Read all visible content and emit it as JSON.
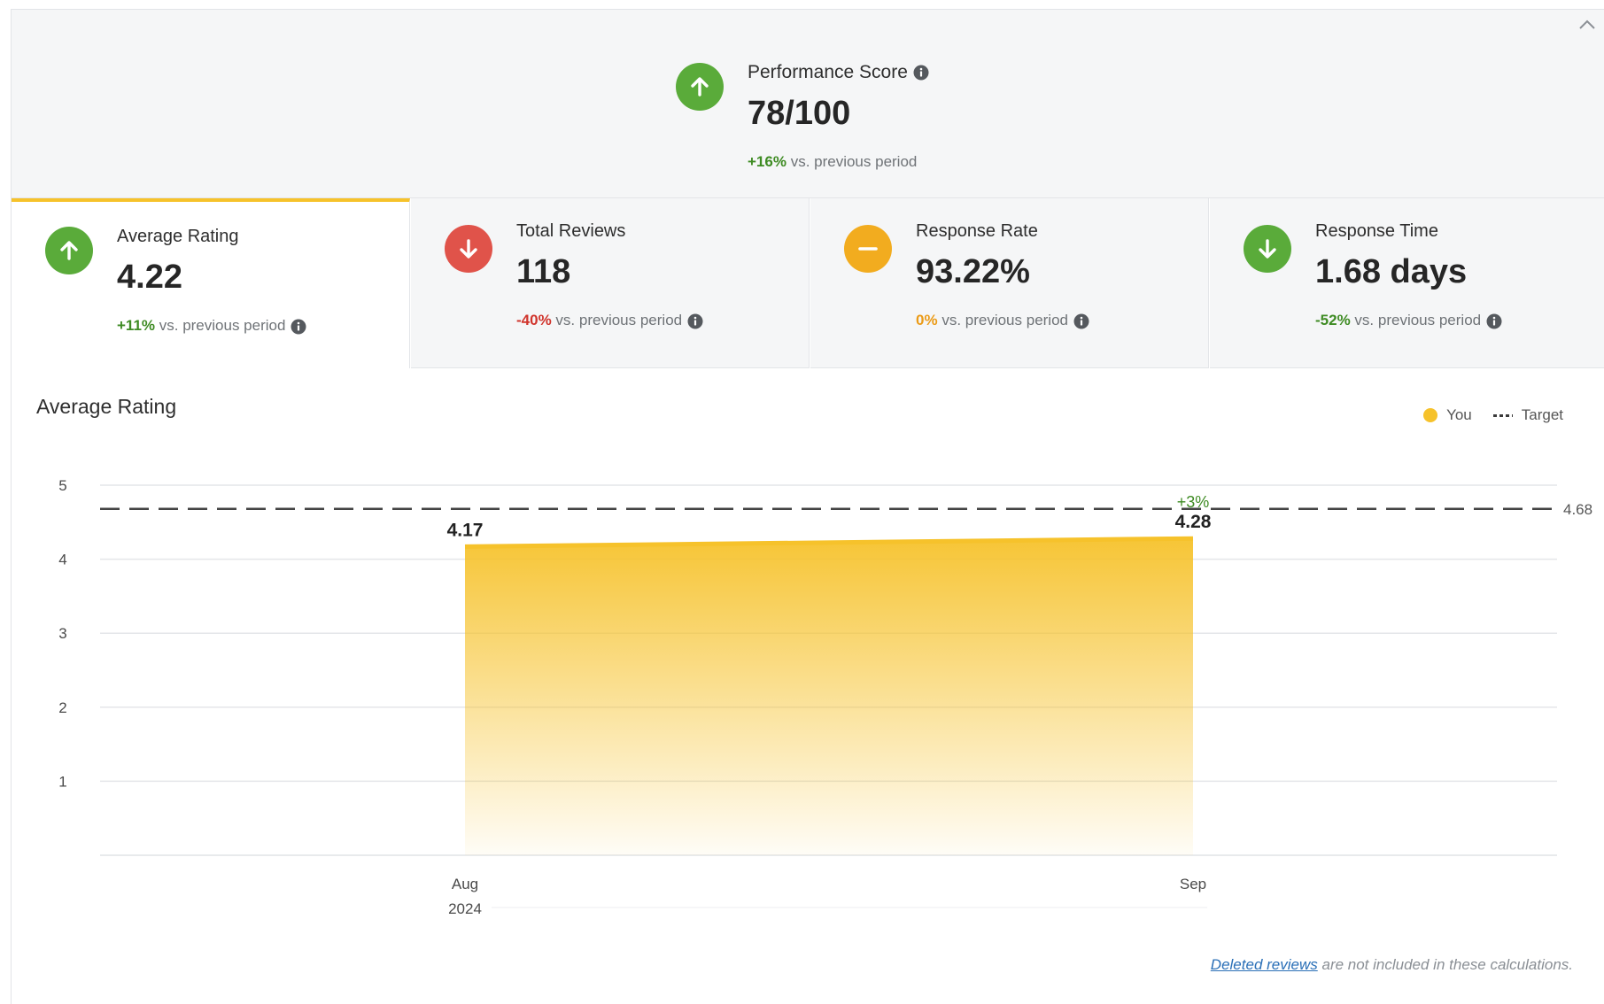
{
  "header": {
    "performance": {
      "label": "Performance Score",
      "value": "78/100",
      "delta": "+16%",
      "delta_suffix": "vs. previous period",
      "trend": "up"
    }
  },
  "tiles": [
    {
      "label": "Average Rating",
      "value": "4.22",
      "delta": "+11%",
      "delta_suffix": "vs. previous period",
      "trend": "up",
      "status": "pos",
      "active": true
    },
    {
      "label": "Total Reviews",
      "value": "118",
      "delta": "-40%",
      "delta_suffix": "vs. previous period",
      "trend": "down",
      "status": "neg",
      "active": false
    },
    {
      "label": "Response Rate",
      "value": "93.22%",
      "delta": "0%",
      "delta_suffix": "vs. previous period",
      "trend": "flat",
      "status": "neu",
      "active": false
    },
    {
      "label": "Response Time",
      "value": "1.68 days",
      "delta": "-52%",
      "delta_suffix": "vs. previous period",
      "trend": "down",
      "status": "pos",
      "active": false
    }
  ],
  "chart": {
    "title": "Average Rating",
    "legend": {
      "you": "You",
      "target": "Target"
    }
  },
  "chart_data": {
    "type": "area",
    "title": "Average Rating",
    "categories": [
      "Aug",
      "Sep"
    ],
    "year_label": "2024",
    "series": [
      {
        "name": "You",
        "values": [
          4.17,
          4.28
        ],
        "color": "#f6c22b"
      }
    ],
    "target": {
      "name": "Target",
      "value": 4.68,
      "label": "4.68"
    },
    "point_labels": [
      "4.17",
      "4.28"
    ],
    "change_label": "+3%",
    "yticks": [
      1,
      2,
      3,
      4,
      5
    ],
    "ylim": [
      0,
      5
    ],
    "grid": true,
    "legend_position": "top-right"
  },
  "footer": {
    "link_text": "Deleted reviews",
    "text": "are not included in these calculations."
  },
  "colors": {
    "accent": "#f6c22b",
    "positive": "#5aab3a",
    "negative": "#e0534a",
    "neutral": "#f2ac1f",
    "link": "#2a6fb7"
  }
}
